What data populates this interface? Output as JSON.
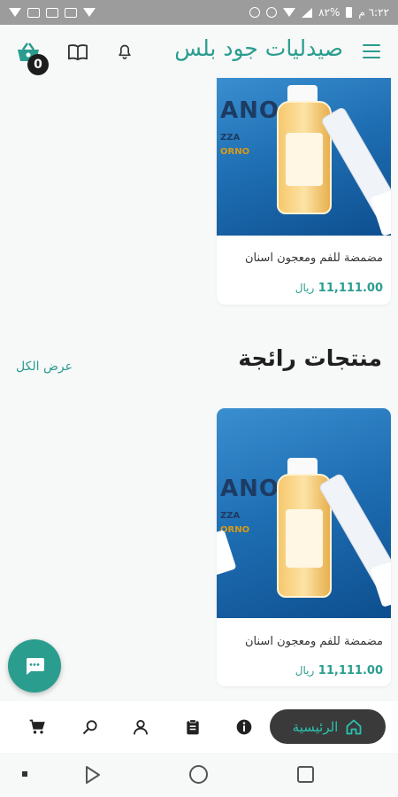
{
  "status_bar": {
    "time": "٦:٢٢ م",
    "battery": "٨٢%"
  },
  "header": {
    "title": "صيدليات جود بلس",
    "cart_count": "0"
  },
  "products_top": [
    {
      "name": "مضمضة للفم ومعجون اسنان",
      "price": "11,111.00",
      "currency": "ريال",
      "image_text": "ANO",
      "image_sub1": "ZZA",
      "image_sub2": "ORNO"
    }
  ],
  "featured": {
    "title": "منتجات رائجة",
    "view_all": "عرض الكل",
    "products": [
      {
        "name": "مضمضة للفم ومعجون اسنان",
        "price": "11,111.00",
        "currency": "ريال",
        "image_text": "ANO",
        "image_sub1": "ZZA",
        "image_sub2": "ORNO"
      }
    ]
  },
  "bottom_nav": {
    "home_label": "الرئيسية",
    "items": [
      "cart-icon",
      "search-icon",
      "profile-icon",
      "clipboard-icon",
      "info-icon",
      "home-icon"
    ]
  },
  "colors": {
    "brand": "#2a9d8f",
    "nav_pill": "#3a3a3a",
    "nav_pill_text": "#2ac2ae"
  }
}
